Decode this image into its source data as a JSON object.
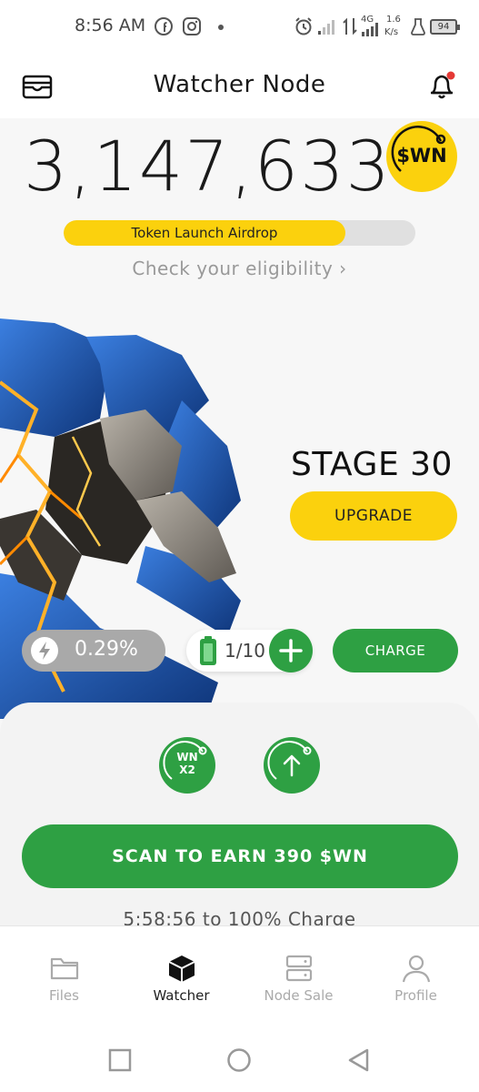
{
  "status_bar": {
    "time": "8:56 AM",
    "network_type": "4G",
    "speed_value": "1.6",
    "speed_unit": "K/s",
    "battery": "94",
    "icons": [
      "facebook-icon",
      "instagram-icon",
      "alarm-icon",
      "signal-icon",
      "data-arrows-icon",
      "signal-4g-icon",
      "lab-icon",
      "battery-icon"
    ]
  },
  "header": {
    "title": "Watcher Node",
    "left_icon": "wallet-icon",
    "right_icon": "bell-icon",
    "notification_dot_color": "#e53935"
  },
  "balance": {
    "amount": "3,147,633",
    "token_badge": "$WN"
  },
  "airdrop": {
    "label": "Token Launch Airdrop",
    "progress_fraction": 0.8,
    "link": "Check your eligibility ›"
  },
  "node": {
    "stage": "STAGE 30",
    "upgrade_label": "UPGRADE",
    "energy_percent": "0.29%",
    "charges": "1/10",
    "charge_label": "CHARGE"
  },
  "boosts": {
    "wn_line1": "WN",
    "wn_line2": "X2"
  },
  "actions": {
    "scan_label": "SCAN TO EARN 390 $WN",
    "charge_timer": "5:58:56 to 100% Charge"
  },
  "nav": {
    "items": [
      {
        "label": "Files",
        "icon": "folder-icon",
        "active": false
      },
      {
        "label": "Watcher",
        "icon": "cube-icon",
        "active": true
      },
      {
        "label": "Node Sale",
        "icon": "server-icon",
        "active": false
      },
      {
        "label": "Profile",
        "icon": "person-icon",
        "active": false
      }
    ]
  },
  "colors": {
    "accent_yellow": "#fbd10d",
    "accent_green": "#2ea043",
    "node_blue": "#1e5fb8"
  }
}
